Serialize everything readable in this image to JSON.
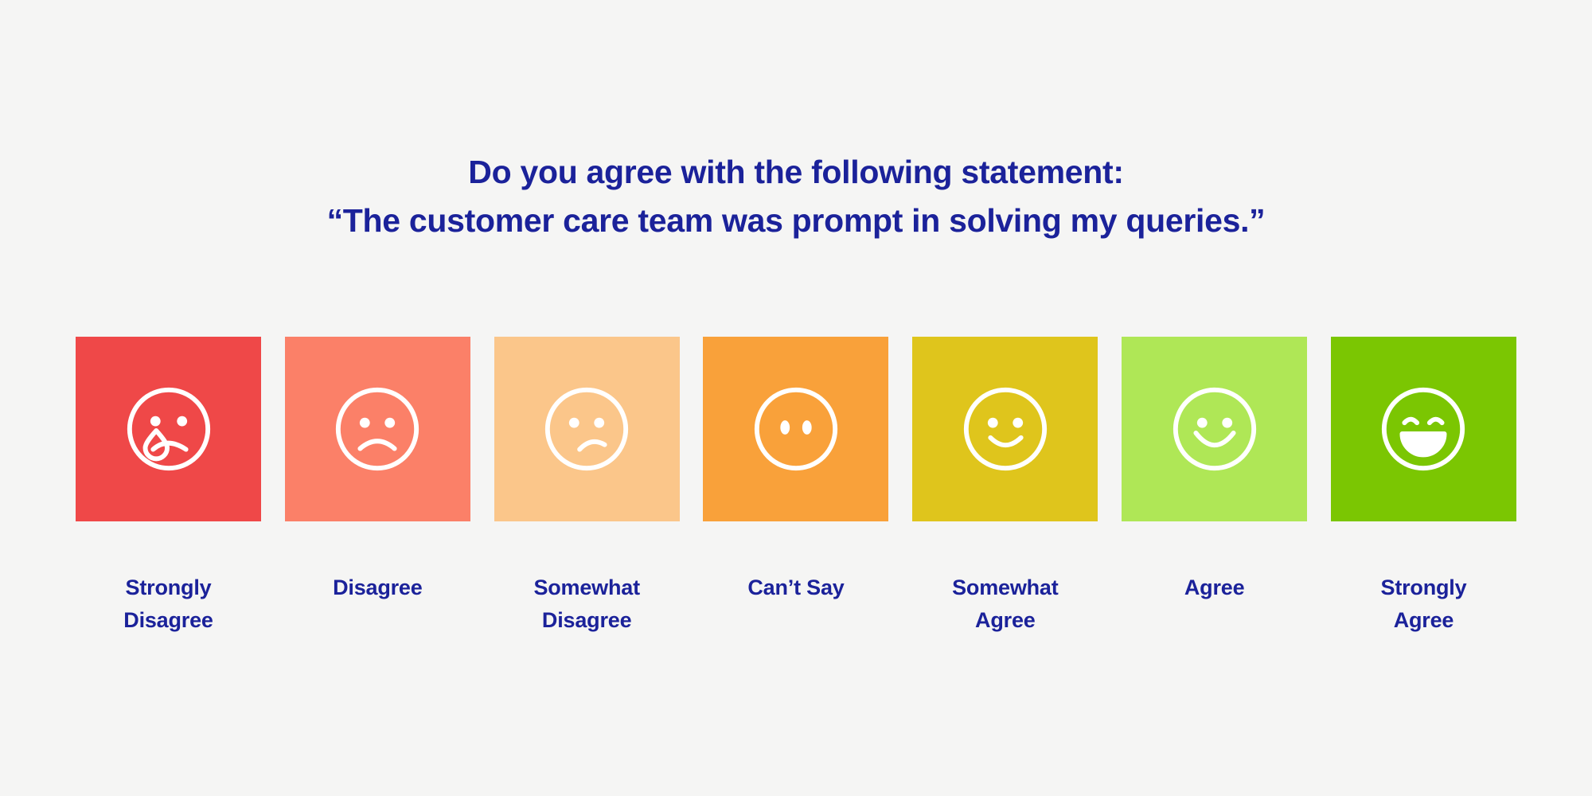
{
  "background_color": "#F5F5F4",
  "title": {
    "line1": "Do you agree with the following statement:",
    "line2": "“The customer care team was prompt in solving my queries.”",
    "color": "#1B229A"
  },
  "scale": {
    "label_color": "#1B229A",
    "icon_color": "#FFFFFF",
    "items": [
      {
        "label": "Strongly\nDisagree",
        "color": "#EF4848",
        "icon": "crying-face-icon",
        "value": 1
      },
      {
        "label": "Disagree",
        "color": "#FB8068",
        "icon": "frowning-face-icon",
        "value": 2
      },
      {
        "label": "Somewhat\nDisagree",
        "color": "#FBC68A",
        "icon": "slightly-frowning-face-icon",
        "value": 3
      },
      {
        "label": "Can’t Say",
        "color": "#F9A13A",
        "icon": "expressionless-face-icon",
        "value": 4
      },
      {
        "label": "Somewhat\nAgree",
        "color": "#DFC51C",
        "icon": "slightly-smiling-face-icon",
        "value": 5
      },
      {
        "label": "Agree",
        "color": "#AFE756",
        "icon": "smiling-face-icon",
        "value": 6
      },
      {
        "label": "Strongly\nAgree",
        "color": "#7BC602",
        "icon": "grinning-face-icon",
        "value": 7
      }
    ]
  }
}
